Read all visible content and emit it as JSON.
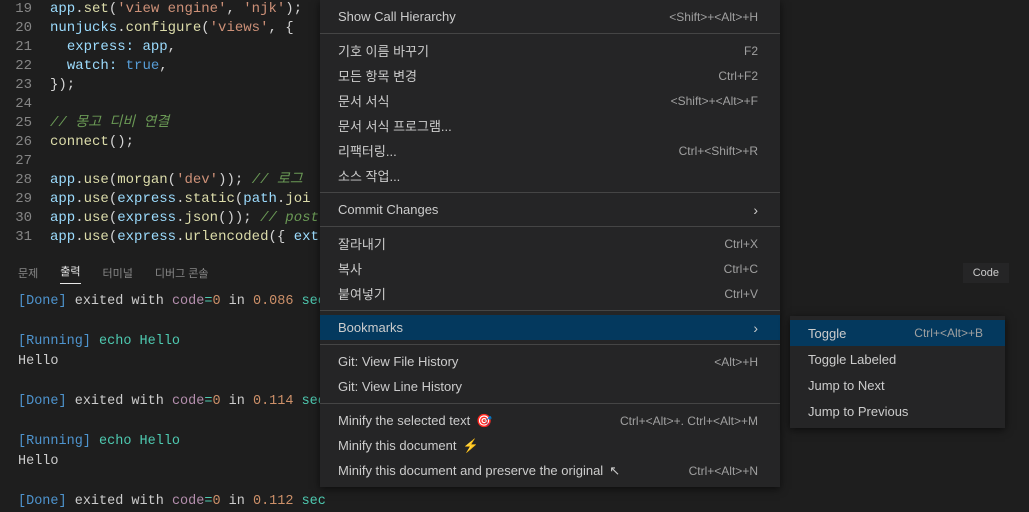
{
  "editor": {
    "lines": [
      {
        "n": 19,
        "html": "<span class='tk-obj'>app</span><span class='tk-punc'>.</span><span class='tk-fn'>set</span><span class='tk-punc'>(</span><span class='tk-str'>'view engine'</span><span class='tk-punc'>, </span><span class='tk-str'>'njk'</span><span class='tk-punc'>);</span>"
      },
      {
        "n": 20,
        "html": "<span class='tk-obj'>nunjucks</span><span class='tk-punc'>.</span><span class='tk-fn'>configure</span><span class='tk-punc'>(</span><span class='tk-str'>'views'</span><span class='tk-punc'>, {</span>"
      },
      {
        "n": 21,
        "html": "  <span class='tk-prop'>express:</span> <span class='tk-obj'>app</span><span class='tk-punc'>,</span>"
      },
      {
        "n": 22,
        "html": "  <span class='tk-prop'>watch:</span> <span class='tk-kw'>true</span><span class='tk-punc'>,</span>"
      },
      {
        "n": 23,
        "html": "<span class='tk-punc'>});</span>"
      },
      {
        "n": 24,
        "html": ""
      },
      {
        "n": 25,
        "html": "<span class='tk-comment'>// 몽고 디비 연결</span>"
      },
      {
        "n": 26,
        "html": "<span class='tk-fn'>connect</span><span class='tk-punc'>();</span>"
      },
      {
        "n": 27,
        "html": ""
      },
      {
        "n": 28,
        "html": "<span class='tk-obj'>app</span><span class='tk-punc'>.</span><span class='tk-fn'>use</span><span class='tk-punc'>(</span><span class='tk-fn'>morgan</span><span class='tk-punc'>(</span><span class='tk-str'>'dev'</span><span class='tk-punc'>));</span> <span class='tk-comment'>// 로그</span>"
      },
      {
        "n": 29,
        "html": "<span class='tk-obj'>app</span><span class='tk-punc'>.</span><span class='tk-fn'>use</span><span class='tk-punc'>(</span><span class='tk-obj'>express</span><span class='tk-punc'>.</span><span class='tk-fn'>static</span><span class='tk-punc'>(</span><span class='tk-obj'>path</span><span class='tk-punc'>.</span><span class='tk-fn'>joi</span>"
      },
      {
        "n": 30,
        "html": "<span class='tk-obj'>app</span><span class='tk-punc'>.</span><span class='tk-fn'>use</span><span class='tk-punc'>(</span><span class='tk-obj'>express</span><span class='tk-punc'>.</span><span class='tk-fn'>json</span><span class='tk-punc'>());</span> <span class='tk-comment'>// post</span>"
      },
      {
        "n": 31,
        "html": "<span class='tk-obj'>app</span><span class='tk-punc'>.</span><span class='tk-fn'>use</span><span class='tk-punc'>(</span><span class='tk-obj'>express</span><span class='tk-punc'>.</span><span class='tk-fn'>urlencoded</span><span class='tk-punc'>({ </span><span class='tk-prop'>ext</span>"
      }
    ]
  },
  "panel": {
    "tabs": [
      "문제",
      "출력",
      "터미널",
      "디버그 콘솔"
    ],
    "active": 1,
    "right": "Code"
  },
  "output": {
    "lines": [
      {
        "type": "done",
        "text": "[Done] ",
        "rest": "exited with ",
        "code": "code",
        "eq": "=",
        "val": "0",
        "in": " in ",
        "num": "0.086",
        "sec": " sec"
      },
      {
        "type": "blank"
      },
      {
        "type": "running",
        "text": "[Running] ",
        "cmd": "echo Hello"
      },
      {
        "type": "plain",
        "text": "Hello"
      },
      {
        "type": "blank"
      },
      {
        "type": "done",
        "text": "[Done] ",
        "rest": "exited with ",
        "code": "code",
        "eq": "=",
        "val": "0",
        "in": " in ",
        "num": "0.114",
        "sec": " sec"
      },
      {
        "type": "blank"
      },
      {
        "type": "running",
        "text": "[Running] ",
        "cmd": "echo Hello"
      },
      {
        "type": "plain",
        "text": "Hello"
      },
      {
        "type": "blank"
      },
      {
        "type": "done",
        "text": "[Done] ",
        "rest": "exited with ",
        "code": "code",
        "eq": "=",
        "val": "0",
        "in": " in ",
        "num": "0.112",
        "sec": " sec"
      }
    ]
  },
  "menu": [
    {
      "type": "item",
      "label": "Show Call Hierarchy",
      "shortcut": "<Shift>+<Alt>+H"
    },
    {
      "type": "sep"
    },
    {
      "type": "item",
      "label": "기호 이름 바꾸기",
      "shortcut": "F2"
    },
    {
      "type": "item",
      "label": "모든 항목 변경",
      "shortcut": "Ctrl+F2"
    },
    {
      "type": "item",
      "label": "문서 서식",
      "shortcut": "<Shift>+<Alt>+F"
    },
    {
      "type": "item",
      "label": "문서 서식 프로그램...",
      "shortcut": ""
    },
    {
      "type": "item",
      "label": "리팩터링...",
      "shortcut": "Ctrl+<Shift>+R"
    },
    {
      "type": "item",
      "label": "소스 작업...",
      "shortcut": ""
    },
    {
      "type": "sep"
    },
    {
      "type": "item",
      "label": "Commit Changes",
      "shortcut": "",
      "chevron": true
    },
    {
      "type": "sep"
    },
    {
      "type": "item",
      "label": "잘라내기",
      "shortcut": "Ctrl+X"
    },
    {
      "type": "item",
      "label": "복사",
      "shortcut": "Ctrl+C"
    },
    {
      "type": "item",
      "label": "붙여넣기",
      "shortcut": "Ctrl+V"
    },
    {
      "type": "sep"
    },
    {
      "type": "item",
      "label": "Bookmarks",
      "shortcut": "",
      "chevron": true,
      "highlighted": true
    },
    {
      "type": "sep"
    },
    {
      "type": "item",
      "label": "Git: View File History",
      "shortcut": "<Alt>+H"
    },
    {
      "type": "item",
      "label": "Git: View Line History",
      "shortcut": ""
    },
    {
      "type": "sep"
    },
    {
      "type": "item",
      "label": "Minify the selected text",
      "emoji": "🎯",
      "shortcut": "Ctrl+<Alt>+. Ctrl+<Alt>+M"
    },
    {
      "type": "item",
      "label": "Minify this document",
      "emoji": "⚡",
      "shortcut": ""
    },
    {
      "type": "item",
      "label": "Minify this document and preserve the original",
      "emoji": "↖",
      "shortcut": "Ctrl+<Alt>+N"
    }
  ],
  "submenu": [
    {
      "label": "Toggle",
      "shortcut": "Ctrl+<Alt>+B",
      "highlighted": true
    },
    {
      "label": "Toggle Labeled",
      "shortcut": ""
    },
    {
      "label": "Jump to Next",
      "shortcut": ""
    },
    {
      "label": "Jump to Previous",
      "shortcut": ""
    }
  ]
}
